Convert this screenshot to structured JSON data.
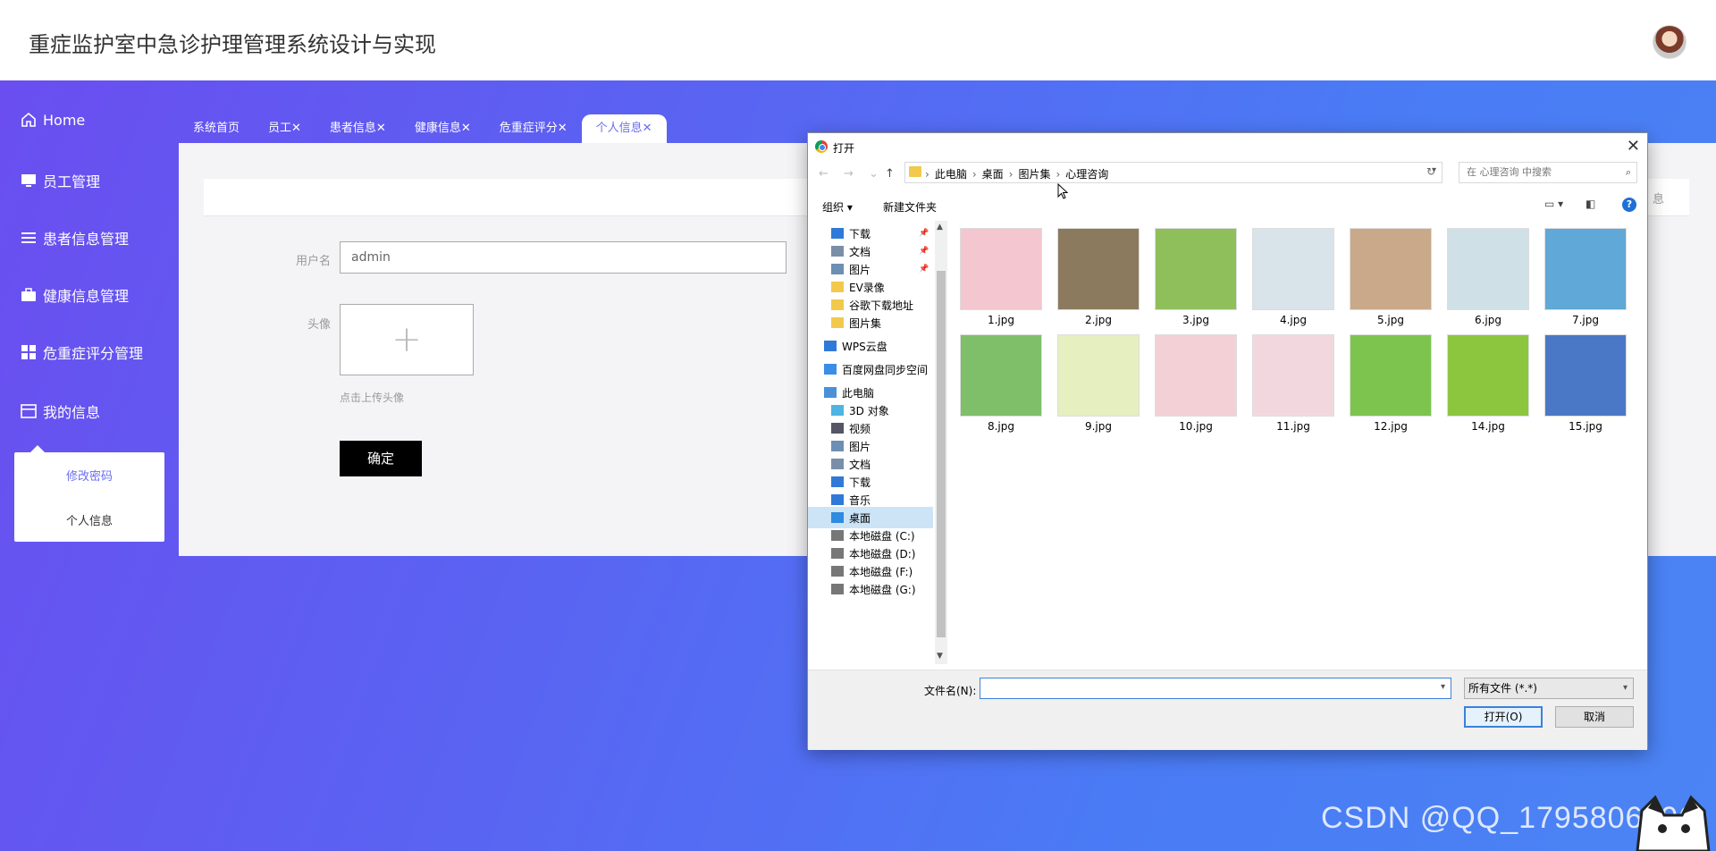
{
  "app": {
    "title": "重症监护室中急诊护理管理系统设计与实现"
  },
  "sidebar": {
    "items": [
      {
        "label": "Home",
        "icon": "home-icon"
      },
      {
        "label": "员工管理",
        "icon": "monitor-icon"
      },
      {
        "label": "患者信息管理",
        "icon": "list-icon"
      },
      {
        "label": "健康信息管理",
        "icon": "briefcase-icon"
      },
      {
        "label": "危重症评分管理",
        "icon": "grid-icon"
      },
      {
        "label": "我的信息",
        "icon": "window-icon"
      }
    ],
    "submenu": [
      "修改密码",
      "个人信息"
    ]
  },
  "tabs": [
    {
      "label": "系统首页"
    },
    {
      "label": "员工✕"
    },
    {
      "label": "患者信息✕"
    },
    {
      "label": "健康信息✕"
    },
    {
      "label": "危重症评分✕"
    },
    {
      "label": "个人信息✕",
      "active": true
    }
  ],
  "form": {
    "crumb_right": "息",
    "username_label": "用户名",
    "username_value": "admin",
    "avatar_label": "头像",
    "upload_hint": "点击上传头像",
    "submit_label": "确定"
  },
  "dialog": {
    "title": "打开",
    "path": [
      "此电脑",
      "桌面",
      "图片集",
      "心理咨询"
    ],
    "search_placeholder": "在 心理咨询 中搜索",
    "organize": "组织 ▾",
    "new_folder": "新建文件夹",
    "tree": [
      {
        "label": "下载",
        "icon": "download-icon",
        "pinned": true
      },
      {
        "label": "文档",
        "icon": "document-icon",
        "pinned": true
      },
      {
        "label": "图片",
        "icon": "pictures-icon",
        "pinned": true
      },
      {
        "label": "EV录像",
        "icon": "folder-icon"
      },
      {
        "label": "谷歌下载地址",
        "icon": "folder-icon"
      },
      {
        "label": "图片集",
        "icon": "folder-icon"
      },
      {
        "label": "WPS云盘",
        "icon": "cloud-icon"
      },
      {
        "label": "百度网盘同步空间",
        "icon": "baidu-icon"
      },
      {
        "label": "此电脑",
        "icon": "computer-icon"
      },
      {
        "label": "3D 对象",
        "icon": "3d-icon"
      },
      {
        "label": "视频",
        "icon": "video-icon"
      },
      {
        "label": "图片",
        "icon": "pictures-icon"
      },
      {
        "label": "文档",
        "icon": "document-icon"
      },
      {
        "label": "下载",
        "icon": "download-icon"
      },
      {
        "label": "音乐",
        "icon": "music-icon"
      },
      {
        "label": "桌面",
        "icon": "desktop-icon",
        "selected": true
      },
      {
        "label": "本地磁盘 (C:)",
        "icon": "drive-icon"
      },
      {
        "label": "本地磁盘 (D:)",
        "icon": "drive-icon"
      },
      {
        "label": "本地磁盘 (F:)",
        "icon": "drive-icon"
      },
      {
        "label": "本地磁盘 (G:)",
        "icon": "drive-icon"
      }
    ],
    "files": [
      {
        "name": "1.jpg",
        "color": "#f4c6cf"
      },
      {
        "name": "2.jpg",
        "color": "#8c7a5e"
      },
      {
        "name": "3.jpg",
        "color": "#8fbf5a"
      },
      {
        "name": "4.jpg",
        "color": "#d9e3ea"
      },
      {
        "name": "5.jpg",
        "color": "#c9a98a"
      },
      {
        "name": "6.jpg",
        "color": "#cfe1e6"
      },
      {
        "name": "7.jpg",
        "color": "#5fa8d8"
      },
      {
        "name": "8.jpg",
        "color": "#7fbf6a"
      },
      {
        "name": "9.jpg",
        "color": "#e6efc0"
      },
      {
        "name": "10.jpg",
        "color": "#f3d0d6"
      },
      {
        "name": "11.jpg",
        "color": "#f2d8de"
      },
      {
        "name": "12.jpg",
        "color": "#7dc44f"
      },
      {
        "name": "14.jpg",
        "color": "#8cc63f"
      },
      {
        "name": "15.jpg",
        "color": "#4b78c6"
      }
    ],
    "filename_label": "文件名(N):",
    "filename_value": "",
    "filetype": "所有文件 (*.*)",
    "open_label": "打开(O)",
    "cancel_label": "取消"
  },
  "watermark": "CSDN @QQ_1795806396"
}
